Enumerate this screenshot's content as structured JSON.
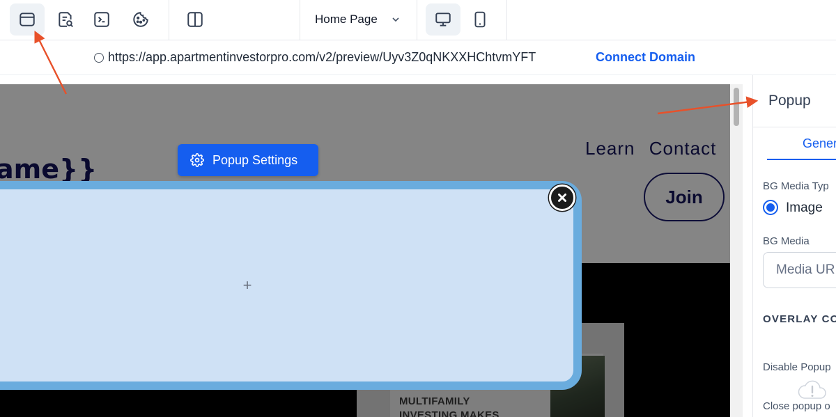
{
  "toolbar": {
    "buttons": [
      {
        "icon": "browser-window-icon",
        "active": true
      },
      {
        "icon": "document-search-icon",
        "active": false
      },
      {
        "icon": "terminal-icon",
        "active": false
      },
      {
        "icon": "cookie-icon",
        "active": false
      },
      {
        "icon": "split-view-icon",
        "active": false
      }
    ],
    "page_select": "Home Page",
    "devices": [
      {
        "icon": "desktop-icon",
        "active": true
      },
      {
        "icon": "mobile-icon",
        "active": false
      }
    ]
  },
  "urlbar": {
    "url": "https://app.apartmentinvestorpro.com/v2/preview/Uyv3Z0qNKXXHChtvmYFT",
    "connect_label": "Connect Domain"
  },
  "preview": {
    "logo_text": "ame}}",
    "nav_links": [
      "Learn",
      "Contact"
    ],
    "join_label": "Join",
    "card_text_line1": "MULTIFAMILY",
    "card_text_line2": "INVESTING MAKES"
  },
  "popup": {
    "settings_label": "Popup Settings",
    "add_symbol": "+"
  },
  "panel": {
    "title": "Popup",
    "tab_label": "Gener",
    "bg_media_type_label": "BG Media Typ",
    "radio_label": "Image",
    "bg_media_label": "BG Media",
    "media_placeholder": "Media UR",
    "overlay_heading": "OVERLAY CO",
    "disable_popup_label": "Disable Popup",
    "close_popup_label": "Close popup o"
  },
  "colors": {
    "accent": "#155eef",
    "popup_fill": "#cfe1f5",
    "popup_border": "#6aacde",
    "annotation_arrow": "#e8512a",
    "site_navy": "#14145a"
  }
}
